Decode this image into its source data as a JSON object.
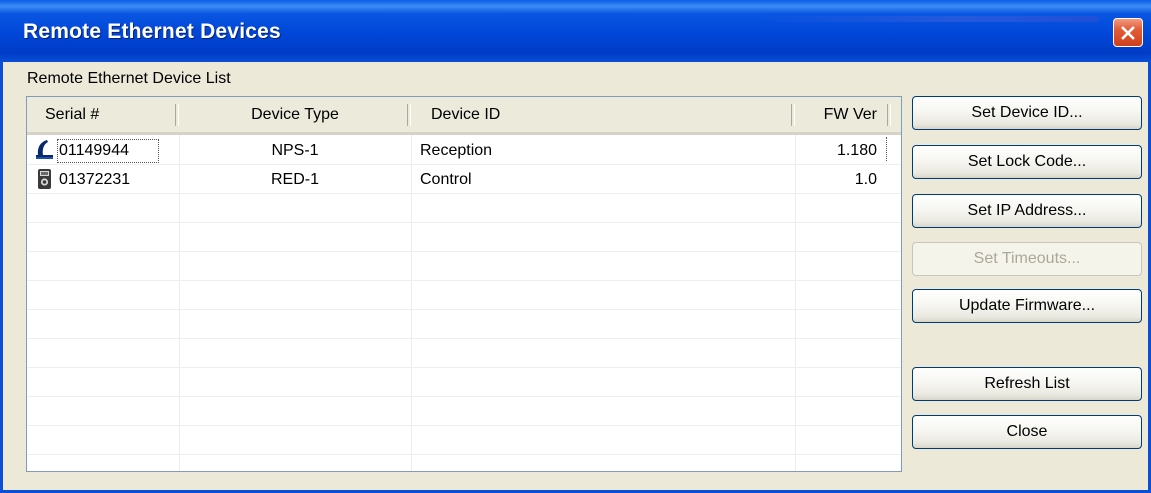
{
  "window": {
    "title": "Remote Ethernet Devices",
    "title_color": "#ffffff",
    "titlebar_color": "#0046d8",
    "close_button_color": "#d0401c"
  },
  "group": {
    "label": "Remote Ethernet Device List"
  },
  "list": {
    "columns": [
      "Serial #",
      "Device Type",
      "Device ID",
      "FW Ver"
    ],
    "rows": [
      {
        "icon": "nps-device-icon",
        "serial": "01149944",
        "type": "NPS-1",
        "id": "Reception",
        "fw": "1.180"
      },
      {
        "icon": "red-device-icon",
        "serial": "01372231",
        "type": "RED-1",
        "id": "Control",
        "fw": "1.0"
      }
    ]
  },
  "buttons": {
    "set_device_id": "Set Device ID...",
    "set_lock_code": "Set Lock Code...",
    "set_ip_address": "Set IP Address...",
    "set_timeouts": "Set Timeouts...",
    "update_firmware": "Update Firmware...",
    "refresh_list": "Refresh List",
    "close": "Close"
  }
}
